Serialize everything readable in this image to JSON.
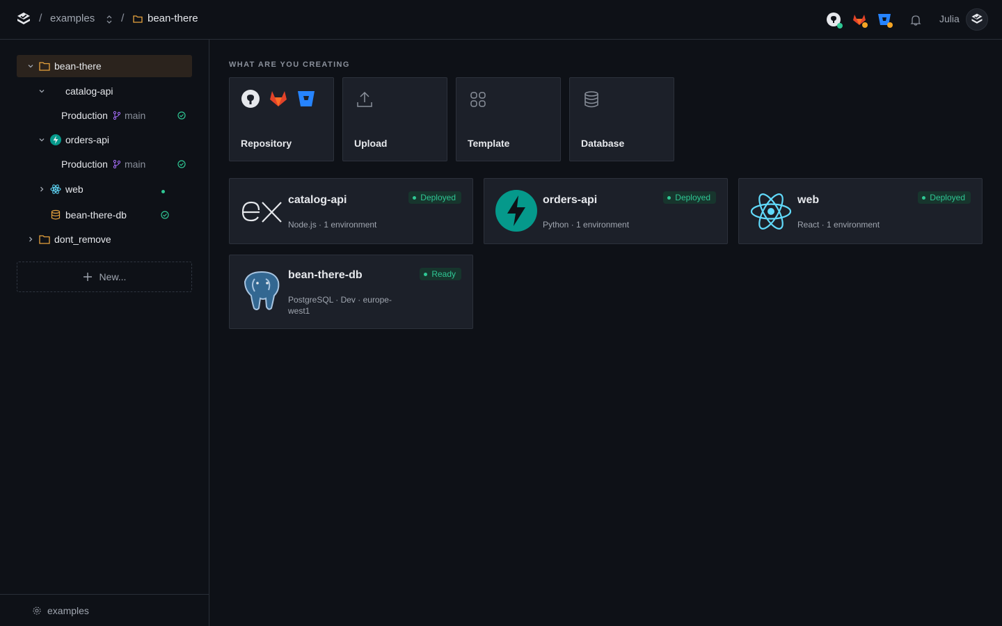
{
  "topbar": {
    "org": "examples",
    "project": "bean-there",
    "user": "Julia"
  },
  "sidebar": {
    "project": "bean-there",
    "catalog": {
      "name": "catalog-api",
      "env": "Production",
      "branch": "main"
    },
    "orders": {
      "name": "orders-api",
      "env": "Production",
      "branch": "main"
    },
    "web": {
      "name": "web"
    },
    "db": {
      "name": "bean-there-db"
    },
    "folder2": {
      "name": "dont_remove"
    },
    "new_label": "New...",
    "footer_label": "examples"
  },
  "main": {
    "section_title": "WHAT ARE YOU CREATING",
    "create_options": {
      "repository": "Repository",
      "upload": "Upload",
      "template": "Template",
      "database": "Database"
    },
    "services": {
      "catalog": {
        "name": "catalog-api",
        "meta": "Node.js · 1 environment",
        "status": "Deployed"
      },
      "orders": {
        "name": "orders-api",
        "meta": "Python · 1 environment",
        "status": "Deployed"
      },
      "web": {
        "name": "web",
        "meta": "React · 1 environment",
        "status": "Deployed"
      },
      "db": {
        "name": "bean-there-db",
        "meta": "PostgreSQL · Dev · europe-west1",
        "status": "Ready"
      }
    }
  },
  "colors": {
    "background": "#0e1117",
    "card": "#1c2029",
    "accent_folder": "#e8a33d",
    "status_green": "#2fc794",
    "branch_purple": "#a970ff"
  }
}
